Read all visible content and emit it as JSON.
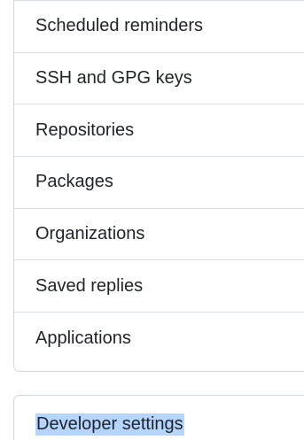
{
  "settings_menu": {
    "items": [
      {
        "label": "Scheduled reminders"
      },
      {
        "label": "SSH and GPG keys"
      },
      {
        "label": "Repositories"
      },
      {
        "label": "Packages"
      },
      {
        "label": "Organizations"
      },
      {
        "label": "Saved replies"
      },
      {
        "label": "Applications"
      }
    ]
  },
  "developer_menu": {
    "label": "Developer settings"
  }
}
